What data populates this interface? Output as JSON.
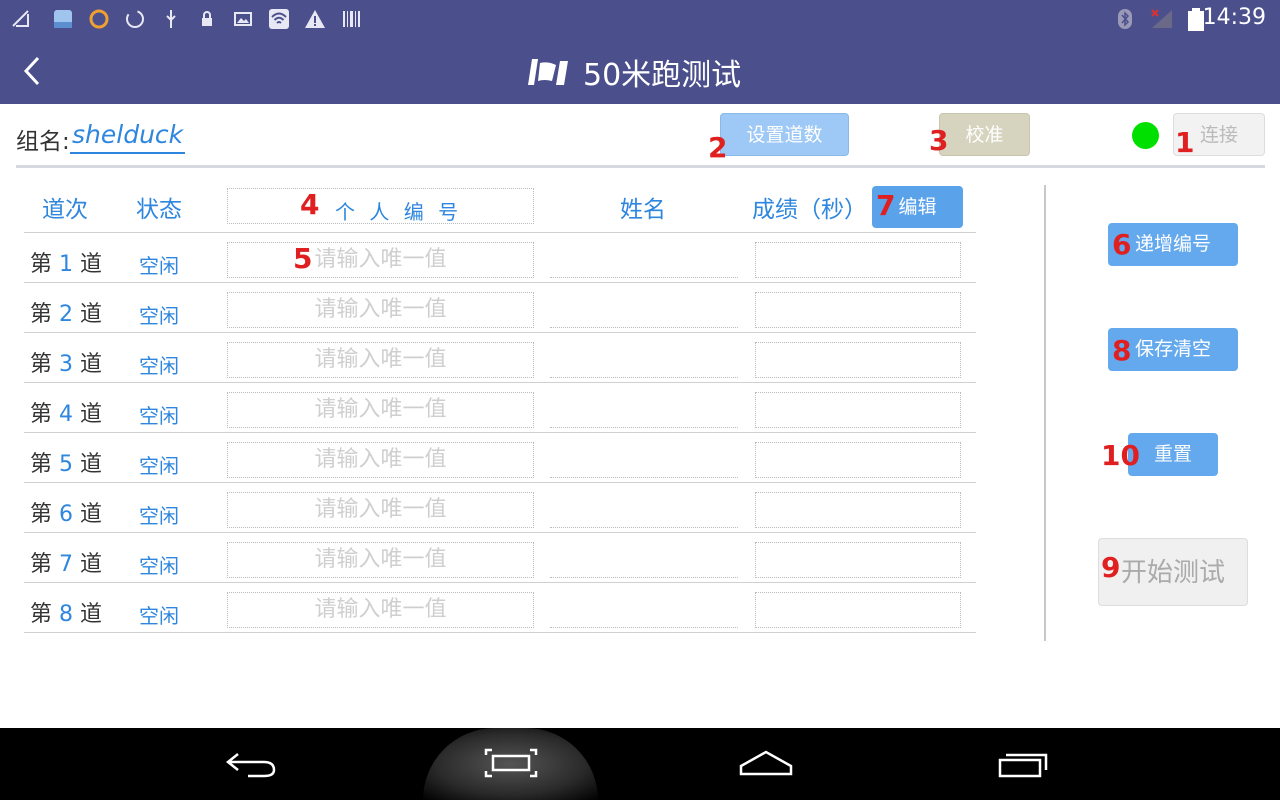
{
  "status_bar": {
    "left_icons": [
      "signal-muted-icon",
      "photo-app-icon",
      "squirrel-app-icon",
      "loading-icon",
      "usb-icon",
      "lock-icon",
      "image-icon",
      "wifi-icon",
      "warning-icon",
      "barcode-icon"
    ],
    "right_icons": [
      "bluetooth-icon",
      "cell-signal-icon",
      "battery-icon"
    ],
    "time": "14:39"
  },
  "title_bar": {
    "title": "50米跑测试"
  },
  "group": {
    "label": "组名:",
    "value": "shelduck"
  },
  "toolbar": {
    "set_lanes": "设置道数",
    "calibrate": "校准",
    "connect": "连接",
    "connected_color": "#00e000"
  },
  "table": {
    "headers": {
      "lane": "道次",
      "status": "状态",
      "person_id": "个 人 编 号",
      "name": "姓名",
      "score": "成绩（秒）"
    },
    "edit_button": "编辑",
    "id_placeholder": "请输入唯一值",
    "rows": [
      {
        "prefix": "第",
        "num": "1",
        "suffix": "道",
        "status": "空闲"
      },
      {
        "prefix": "第",
        "num": "2",
        "suffix": "道",
        "status": "空闲"
      },
      {
        "prefix": "第",
        "num": "3",
        "suffix": "道",
        "status": "空闲"
      },
      {
        "prefix": "第",
        "num": "4",
        "suffix": "道",
        "status": "空闲"
      },
      {
        "prefix": "第",
        "num": "5",
        "suffix": "道",
        "status": "空闲"
      },
      {
        "prefix": "第",
        "num": "6",
        "suffix": "道",
        "status": "空闲"
      },
      {
        "prefix": "第",
        "num": "7",
        "suffix": "道",
        "status": "空闲"
      },
      {
        "prefix": "第",
        "num": "8",
        "suffix": "道",
        "status": "空闲"
      }
    ]
  },
  "side": {
    "increment": "递增编号",
    "save_clear": "保存清空",
    "reset": "重置",
    "start": "开始测试"
  },
  "markers": [
    "1",
    "2",
    "3",
    "4",
    "5",
    "6",
    "7",
    "8",
    "9",
    "10"
  ],
  "colors": {
    "header_bg": "#4b4f8c",
    "accent": "#2e86de",
    "marker": "#e02020"
  }
}
